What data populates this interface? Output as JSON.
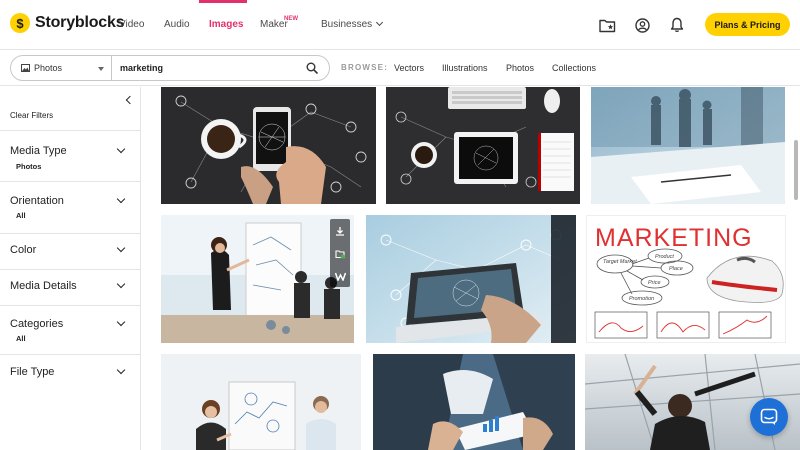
{
  "brand": {
    "logo_mark": "$",
    "name": "Storyblocks",
    "accent": "#e1306c",
    "yellow": "#ffd100"
  },
  "nav": {
    "items": [
      {
        "label": "Video"
      },
      {
        "label": "Audio"
      },
      {
        "label": "Images",
        "active": true
      },
      {
        "label": "Maker",
        "badge": "NEW"
      },
      {
        "label": "Businesses",
        "has_dropdown": true
      }
    ],
    "icons": [
      "folder-star-icon",
      "user-circle-icon",
      "bell-icon"
    ],
    "cta_label": "Plans & Pricing"
  },
  "search": {
    "media_type": "Photos",
    "query": "marketing",
    "browse_label": "BROWSE:",
    "browse_links": [
      "Vectors",
      "Illustrations",
      "Photos",
      "Collections"
    ]
  },
  "sidebar": {
    "clear_filters": "Clear Filters",
    "filters": [
      {
        "title": "Media Type",
        "value": "Photos"
      },
      {
        "title": "Orientation",
        "value": "All"
      },
      {
        "title": "Color",
        "value": ""
      },
      {
        "title": "Media Details",
        "value": ""
      },
      {
        "title": "Categories",
        "value": "All"
      },
      {
        "title": "File Type",
        "value": ""
      }
    ]
  },
  "results": {
    "marketing_sketch_text": "MARKETING",
    "sketch_words": [
      "Target Market",
      "Product",
      "Place",
      "Price",
      "Promotion"
    ]
  }
}
